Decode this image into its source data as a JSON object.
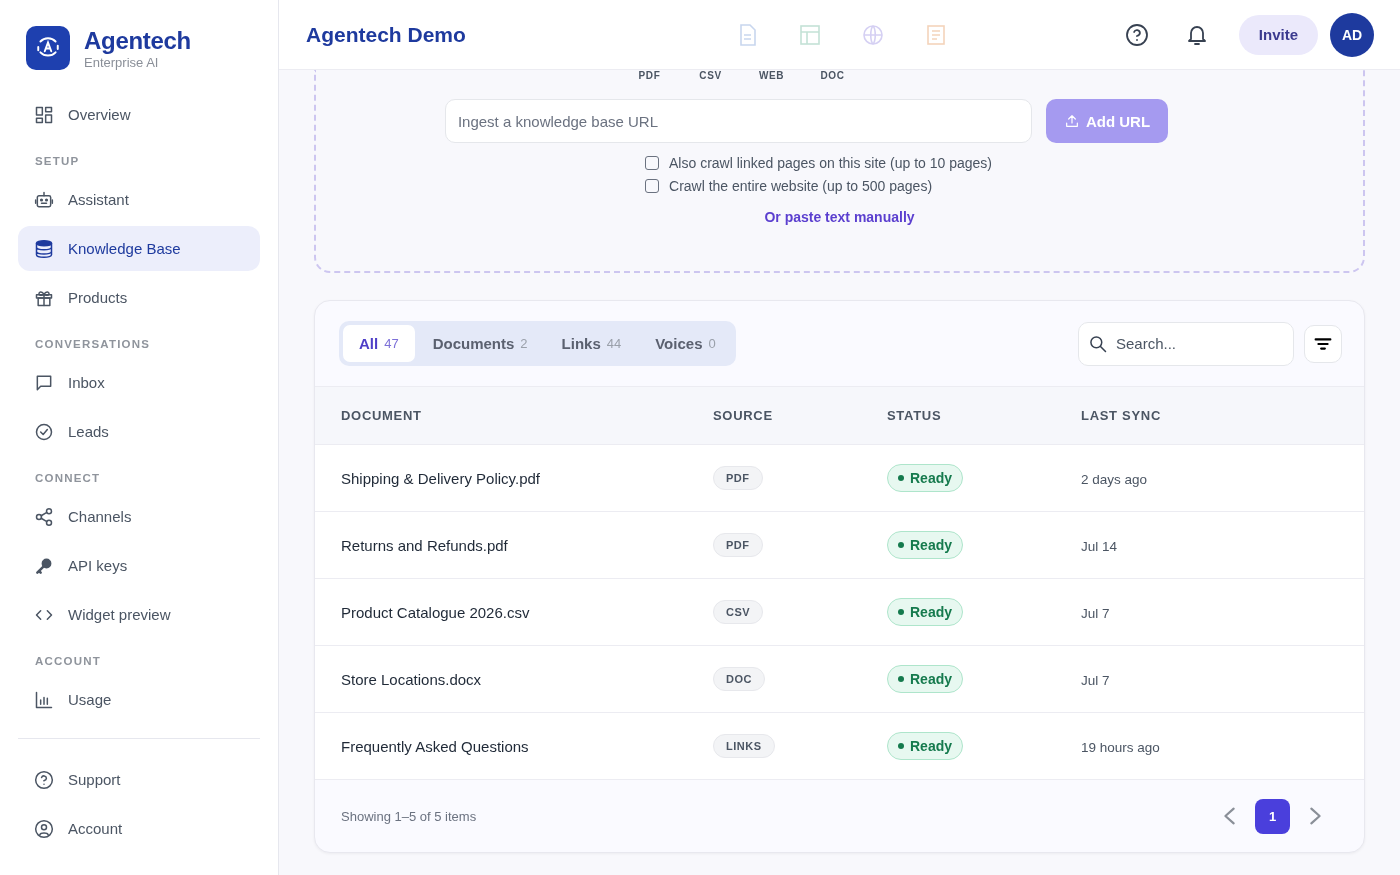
{
  "brand": {
    "name": "Agentech",
    "subtitle": "Enterprise AI"
  },
  "nav": [
    {
      "kind": "item",
      "label": "Overview",
      "selected": false
    },
    {
      "kind": "section",
      "label": "SETUP"
    },
    {
      "kind": "item",
      "label": "Assistant",
      "selected": false
    },
    {
      "kind": "item",
      "label": "Knowledge Base",
      "selected": true
    },
    {
      "kind": "item",
      "label": "Products",
      "selected": false
    },
    {
      "kind": "section",
      "label": "CONVERSATIONS"
    },
    {
      "kind": "item",
      "label": "Inbox",
      "selected": false
    },
    {
      "kind": "item",
      "label": "Leads",
      "selected": false
    },
    {
      "kind": "section",
      "label": "CONNECT"
    },
    {
      "kind": "item",
      "label": "Channels",
      "selected": false
    },
    {
      "kind": "item",
      "label": "API keys",
      "selected": false
    },
    {
      "kind": "item",
      "label": "Widget preview",
      "selected": false
    },
    {
      "kind": "section",
      "label": "ACCOUNT"
    },
    {
      "kind": "item",
      "label": "Usage",
      "selected": false
    }
  ],
  "footer_nav": [
    {
      "label": "Support",
      "selected": false
    },
    {
      "label": "Account",
      "selected": false
    }
  ],
  "header": {
    "title": "Agentech Demo",
    "invite": "Invite",
    "avatar": "AD"
  },
  "file_types": [
    {
      "label": "PDF",
      "color": "#c8d6ee"
    },
    {
      "label": "CSV",
      "color": "#c4e2d6"
    },
    {
      "label": "WEB",
      "color": "#d5d0f3"
    },
    {
      "label": "DOC",
      "color": "#f4d4bb"
    }
  ],
  "ingest": {
    "placeholder": "Ingest a knowledge base URL",
    "button": "Add URL",
    "options": [
      {
        "label": "Also crawl linked pages on this site (up to 10 pages)",
        "checked": false
      },
      {
        "label": "Crawl the entire website (up to 500 pages)",
        "checked": false
      }
    ],
    "paste_link": "Or paste text manually"
  },
  "tabs": [
    {
      "label": "All",
      "count": "47",
      "selected": true
    },
    {
      "label": "Documents",
      "count": "2",
      "selected": false
    },
    {
      "label": "Links",
      "count": "44",
      "selected": false
    },
    {
      "label": "Voices",
      "count": "0",
      "selected": false
    }
  ],
  "search": {
    "placeholder": "Search..."
  },
  "table": {
    "columns": [
      "DOCUMENT",
      "SOURCE",
      "STATUS",
      "LAST SYNC"
    ],
    "rows": [
      {
        "document": "Shipping & Delivery Policy.pdf",
        "source": "PDF",
        "status": "Ready",
        "last_sync": "2 days ago"
      },
      {
        "document": "Returns and Refunds.pdf",
        "source": "PDF",
        "status": "Ready",
        "last_sync": "Jul 14"
      },
      {
        "document": "Product Catalogue 2026.csv",
        "source": "CSV",
        "status": "Ready",
        "last_sync": "Jul 7"
      },
      {
        "document": "Store Locations.docx",
        "source": "DOC",
        "status": "Ready",
        "last_sync": "Jul 7"
      },
      {
        "document": "Frequently Asked Questions",
        "source": "LINKS",
        "status": "Ready",
        "last_sync": "19 hours ago"
      }
    ]
  },
  "pagination": {
    "summary": "Showing 1–5 of 5 items",
    "pages": [
      {
        "label": "1",
        "selected": true
      }
    ]
  }
}
